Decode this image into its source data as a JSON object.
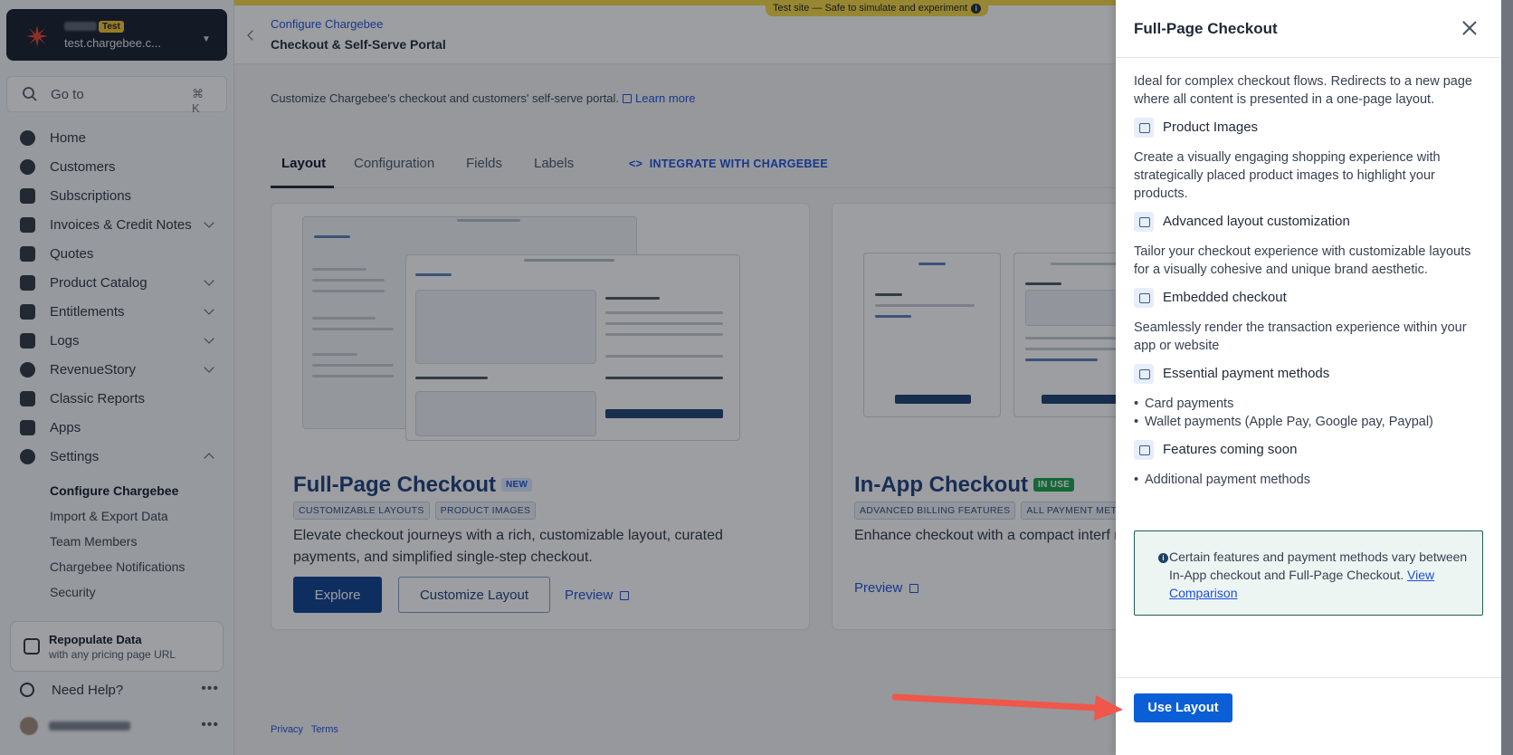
{
  "banner": {
    "text": "Test site — Safe to simulate and experiment",
    "info_icon": "info-icon"
  },
  "org": {
    "badge": "Test",
    "site": "test.chargebee.c..."
  },
  "goto": {
    "label": "Go to",
    "shortcut": "⌘ K"
  },
  "nav": {
    "items": [
      {
        "label": "Home",
        "icon": "home-icon",
        "chevron": false
      },
      {
        "label": "Customers",
        "icon": "customers-icon",
        "chevron": false
      },
      {
        "label": "Subscriptions",
        "icon": "subscriptions-icon",
        "chevron": false
      },
      {
        "label": "Invoices & Credit Notes",
        "icon": "invoice-icon",
        "chevron": true
      },
      {
        "label": "Quotes",
        "icon": "quotes-icon",
        "chevron": false
      },
      {
        "label": "Product Catalog",
        "icon": "catalog-icon",
        "chevron": true
      },
      {
        "label": "Entitlements",
        "icon": "crown-icon",
        "chevron": true
      },
      {
        "label": "Logs",
        "icon": "logs-icon",
        "chevron": true
      },
      {
        "label": "RevenueStory",
        "icon": "revenue-icon",
        "chevron": true
      },
      {
        "label": "Classic Reports",
        "icon": "reports-icon",
        "chevron": false
      },
      {
        "label": "Apps",
        "icon": "apps-icon",
        "chevron": false
      },
      {
        "label": "Settings",
        "icon": "gear-icon",
        "chevron": true
      }
    ],
    "settings_sub": [
      {
        "label": "Configure Chargebee",
        "active": true
      },
      {
        "label": "Import & Export Data",
        "active": false
      },
      {
        "label": "Team Members",
        "active": false
      },
      {
        "label": "Chargebee Notifications",
        "active": false
      },
      {
        "label": "Security",
        "active": false
      }
    ]
  },
  "repopulate": {
    "title": "Repopulate Data",
    "subtitle": "with any pricing page URL"
  },
  "help": {
    "label": "Need Help?",
    "more": "•••"
  },
  "user": {
    "more": "•••"
  },
  "header": {
    "breadcrumb": "Configure Chargebee",
    "title": "Checkout & Self-Serve Portal"
  },
  "description": {
    "text": "Customize Chargebee's checkout and customers' self-serve portal.",
    "link": "Learn more"
  },
  "tabs": {
    "items": [
      "Layout",
      "Configuration",
      "Fields",
      "Labels"
    ],
    "integrate": "INTEGRATE WITH CHARGEBEE"
  },
  "cards": {
    "full": {
      "title": "Full-Page Checkout",
      "badge": "NEW",
      "tags": [
        "CUSTOMIZABLE LAYOUTS",
        "PRODUCT IMAGES"
      ],
      "desc": "Elevate checkout journeys with a rich, customizable layout, curated payments, and simplified single-step checkout.",
      "explore": "Explore",
      "customize": "Customize Layout",
      "preview": "Preview"
    },
    "inapp": {
      "title": "In-App Checkout",
      "badge": "IN USE",
      "tags": [
        "ADVANCED BILLING FEATURES",
        "ALL PAYMENT METHO"
      ],
      "desc": "Enhance checkout with a compact interf robust billing.",
      "preview": "Preview"
    }
  },
  "footer": {
    "privacy": "Privacy",
    "terms": "Terms"
  },
  "drawer": {
    "title": "Full-Page Checkout",
    "intro": "Ideal for complex checkout flows. Redirects to a new page where all content is presented in a one-page layout.",
    "features": [
      {
        "title": "Product Images",
        "icon": "image-icon",
        "desc": "Create a visually engaging shopping experience with strategically placed product images to highlight your products."
      },
      {
        "title": "Advanced layout customization",
        "icon": "brush-icon",
        "desc": "Tailor your checkout experience with customizable layouts for a visually cohesive and unique brand aesthetic."
      },
      {
        "title": "Embedded checkout",
        "icon": "monitor-icon",
        "desc": "Seamlessly render the transaction experience within your app or website"
      },
      {
        "title": "Essential payment methods",
        "icon": "payment-icon",
        "list": [
          "Card payments",
          "Wallet payments (Apple Pay, Google pay, Paypal)"
        ]
      },
      {
        "title": "Features coming soon",
        "icon": "clock-icon",
        "list": [
          "Additional payment methods"
        ]
      }
    ],
    "note": {
      "text": "Certain features and payment methods vary between In-App checkout and Full-Page Checkout.",
      "link": "View Comparison"
    },
    "cta": "Use Layout"
  },
  "colors": {
    "primary": "#0b5fd6",
    "brand_dark": "#1d3d7a",
    "banner": "#f6d743",
    "annotation_arrow": "#f0564a"
  }
}
